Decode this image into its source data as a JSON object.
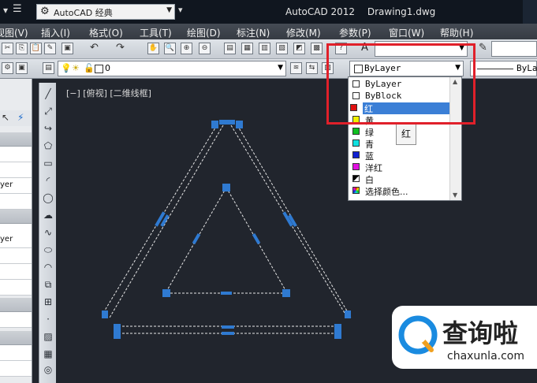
{
  "app": {
    "workspace": "AutoCAD 经典",
    "title_app": "AutoCAD 2012",
    "title_doc": "Drawing1.dwg"
  },
  "menu": [
    {
      "label": "视图(V)",
      "id": "view"
    },
    {
      "label": "插入(I)",
      "id": "insert"
    },
    {
      "label": "格式(O)",
      "id": "format"
    },
    {
      "label": "工具(T)",
      "id": "tools"
    },
    {
      "label": "绘图(D)",
      "id": "draw"
    },
    {
      "label": "标注(N)",
      "id": "dimension"
    },
    {
      "label": "修改(M)",
      "id": "modify"
    },
    {
      "label": "参数(P)",
      "id": "parametric"
    },
    {
      "label": "窗口(W)",
      "id": "window"
    },
    {
      "label": "帮助(H)",
      "id": "help"
    }
  ],
  "layer_combo": {
    "value": "0"
  },
  "color_combo": {
    "value": "ByLayer"
  },
  "linetype_combo": {
    "value": "ByLa"
  },
  "viewport_label": "[−] [俯视] [二维线框]",
  "color_list": {
    "options": [
      {
        "label": "ByLayer",
        "swatch": "#ffffff"
      },
      {
        "label": "ByBlock",
        "swatch": "#ffffff"
      },
      {
        "label": "红",
        "swatch": "#e01010"
      },
      {
        "label": "黄",
        "swatch": "#f0f000"
      },
      {
        "label": "绿",
        "swatch": "#10c020"
      },
      {
        "label": "青",
        "swatch": "#10e0e0"
      },
      {
        "label": "蓝",
        "swatch": "#1020d0"
      },
      {
        "label": "洋红",
        "swatch": "#e010e0"
      },
      {
        "label": "白",
        "swatch": "#000000"
      },
      {
        "label": "选择颜色...",
        "swatch": "#888888"
      }
    ],
    "selected": "红"
  },
  "tooltip": "红",
  "left_panel": {
    "layer_1": "yer",
    "layer_2": "yer"
  },
  "watermark": {
    "brand": "查询啦",
    "url": "chaxunla.com"
  },
  "colors": {
    "accent": "#2f7ad1",
    "highlight_box": "#e0202a",
    "background": "#21252d"
  }
}
